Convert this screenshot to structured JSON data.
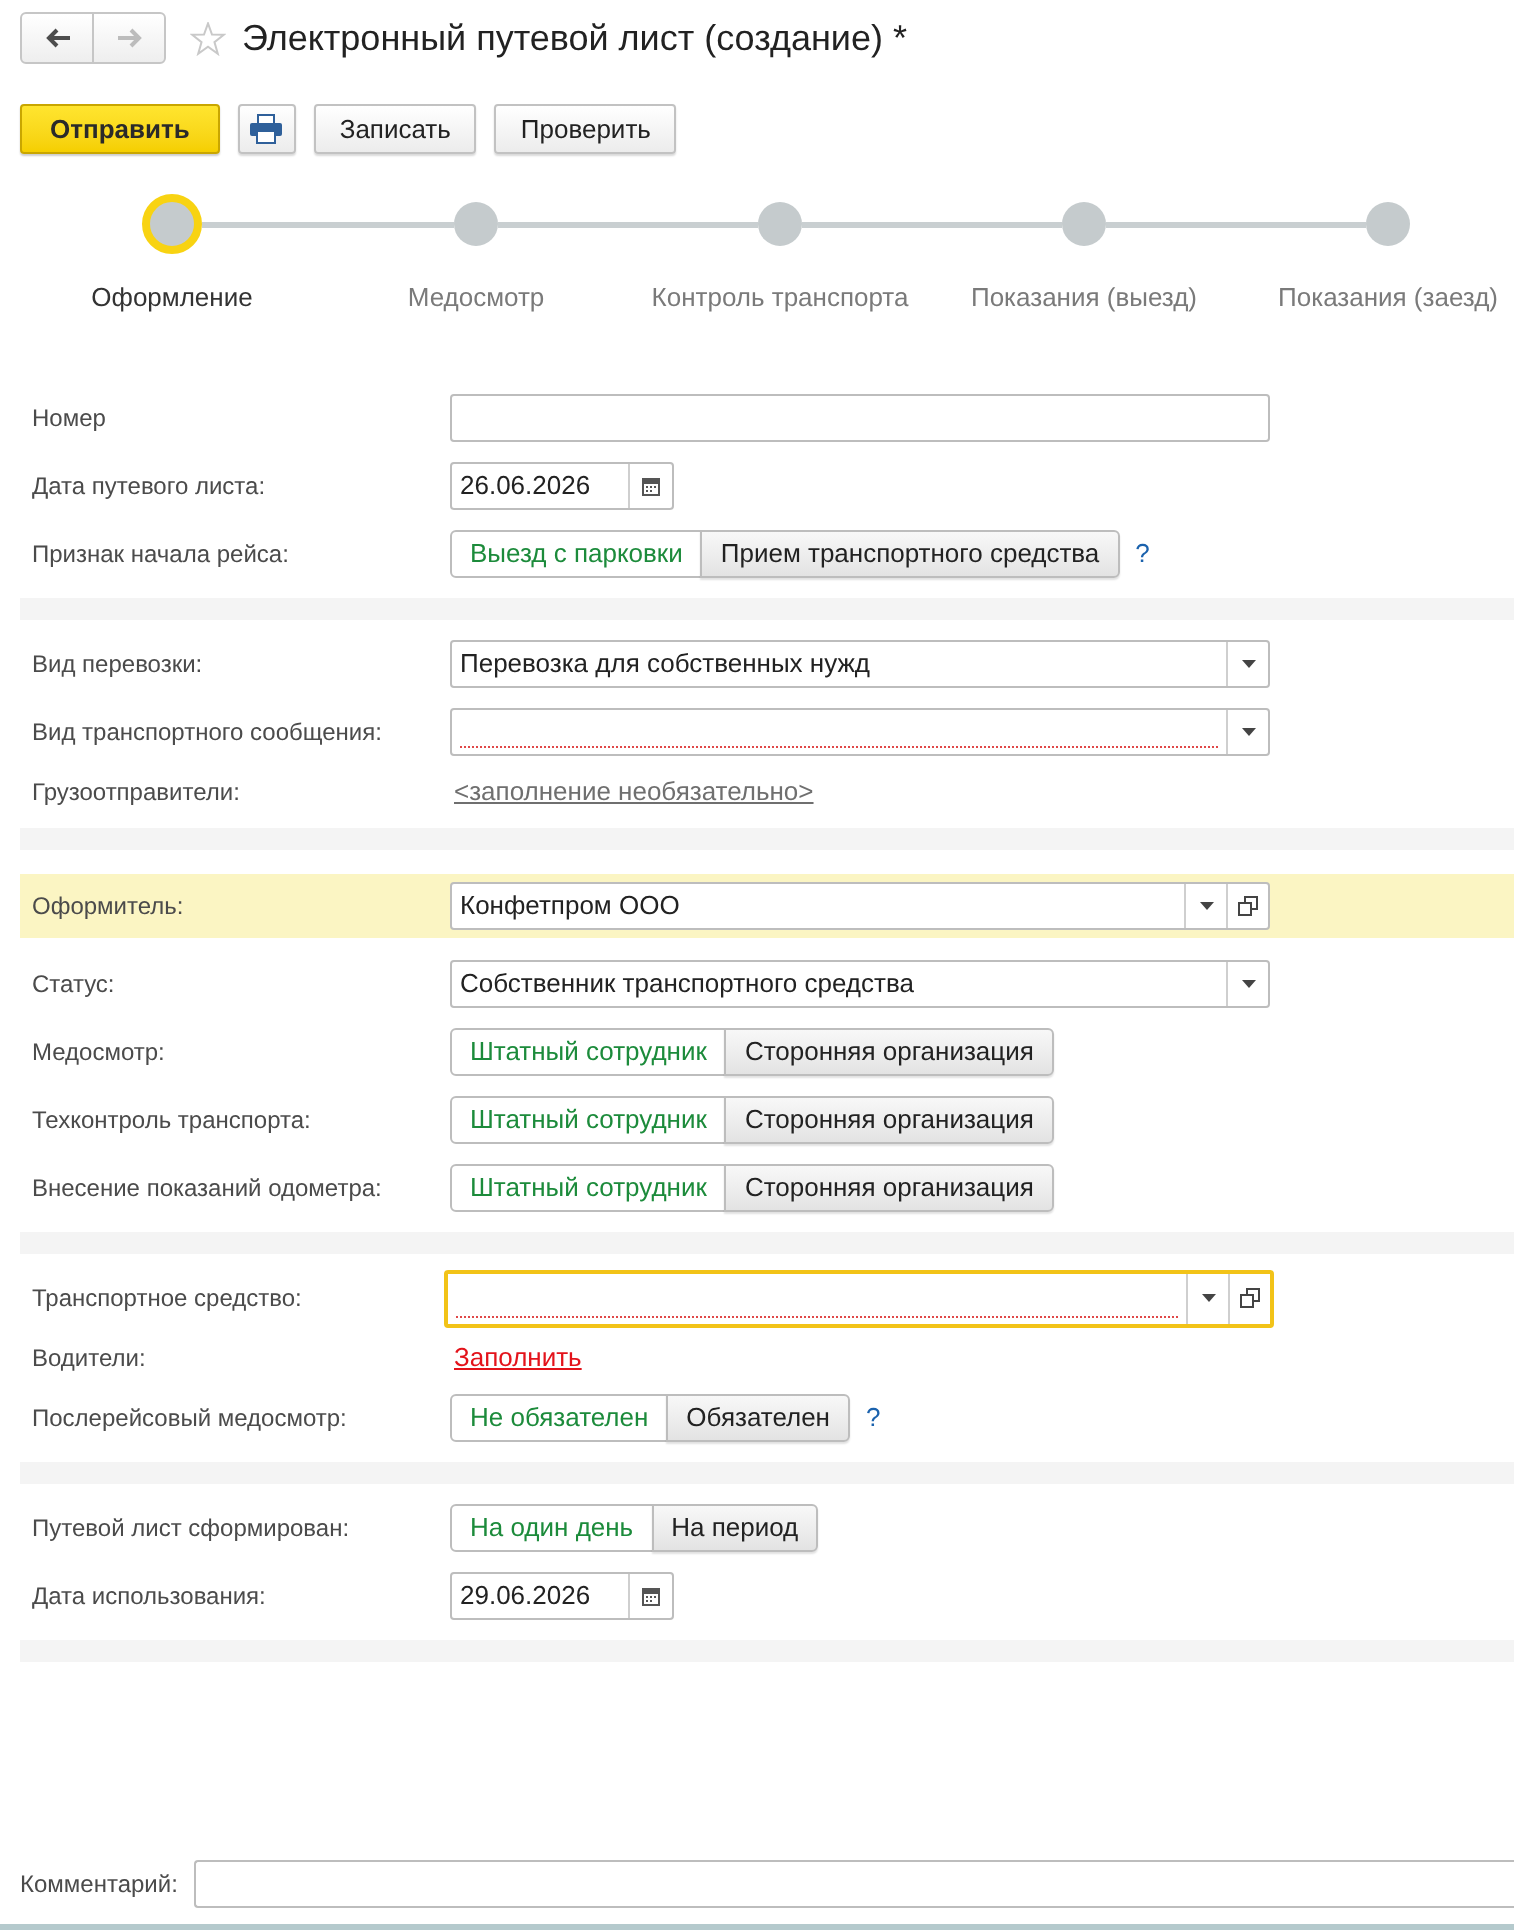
{
  "window": {
    "title": "Электронный путевой лист (создание) *",
    "favorite": false
  },
  "navigation": [
    {
      "kind": "back",
      "disabled": false
    },
    {
      "kind": "forward",
      "disabled": true
    }
  ],
  "toolbar": [
    {
      "kind": "primary",
      "label": "Отправить"
    },
    {
      "kind": "print"
    },
    {
      "kind": "default",
      "label": "Записать"
    },
    {
      "kind": "default",
      "label": "Проверить"
    }
  ],
  "steps": [
    {
      "label": "Оформление",
      "selected": true
    },
    {
      "label": "Медосмотр",
      "selected": false
    },
    {
      "label": "Контроль транспорта",
      "selected": false
    },
    {
      "label": "Показания (выезд)",
      "selected": false
    },
    {
      "label": "Показания (заезд)",
      "selected": false
    }
  ],
  "sections": [
    {
      "fields": [
        {
          "kind": "input",
          "label": "Номер"
        },
        {
          "kind": "date",
          "label": "Дата путевого листа:",
          "value": "26.06.2026"
        },
        {
          "kind": "toggle",
          "label": "Признак начала рейса:",
          "options": [
            {
              "label": "Выезд с парковки",
              "selected": true
            },
            {
              "label": "Прием транспортного средства",
              "selected": false
            }
          ],
          "help": "?"
        }
      ]
    },
    {
      "fields": [
        {
          "kind": "combo",
          "label": "Вид перевозки:",
          "value": "Перевозка для собственных нужд",
          "required": false,
          "focused": false,
          "highlighted": false,
          "open_button": false
        },
        {
          "kind": "combo",
          "label": "Вид транспортного сообщения:",
          "required": true,
          "focused": false,
          "highlighted": false,
          "open_button": false
        },
        {
          "kind": "link",
          "label": "Грузоотправители:",
          "text": "<заполнение необязательно>",
          "required": false
        }
      ]
    },
    {
      "fields": [
        {
          "kind": "combo",
          "label": "Оформитель:",
          "value": "Конфетпром ООО",
          "required": false,
          "focused": false,
          "highlighted": true,
          "open_button": true
        },
        {
          "kind": "combo",
          "label": "Статус:",
          "value": "Собственник транспортного средства",
          "required": false,
          "focused": false,
          "highlighted": false,
          "open_button": false
        },
        {
          "kind": "toggle",
          "label": "Медосмотр:",
          "options": [
            {
              "label": "Штатный сотрудник",
              "selected": true
            },
            {
              "label": "Сторонняя организация",
              "selected": false
            }
          ]
        },
        {
          "kind": "toggle",
          "label": "Техконтроль транспорта:",
          "options": [
            {
              "label": "Штатный сотрудник",
              "selected": true
            },
            {
              "label": "Сторонняя организация",
              "selected": false
            }
          ]
        },
        {
          "kind": "toggle",
          "label": "Внесение показаний одометра:",
          "options": [
            {
              "label": "Штатный сотрудник",
              "selected": true
            },
            {
              "label": "Сторонняя организация",
              "selected": false
            }
          ]
        }
      ]
    },
    {
      "fields": [
        {
          "kind": "combo",
          "label": "Транспортное средство:",
          "required": true,
          "focused": true,
          "highlighted": false,
          "open_button": true
        },
        {
          "kind": "link",
          "label": "Водители:",
          "text": "Заполнить",
          "required": true
        },
        {
          "kind": "toggle",
          "label": "Послерейсовый медосмотр:",
          "options": [
            {
              "label": "Не обязателен",
              "selected": true
            },
            {
              "label": "Обязателен",
              "selected": false
            }
          ],
          "help": "?"
        }
      ]
    },
    {
      "fields": [
        {
          "kind": "toggle",
          "label": "Путевой лист сформирован:",
          "options": [
            {
              "label": "На один день",
              "selected": true
            },
            {
              "label": "На период",
              "selected": false
            }
          ]
        },
        {
          "kind": "date",
          "label": "Дата использования:",
          "value": "29.06.2026"
        }
      ]
    }
  ],
  "comment": {
    "label": "Комментарий:"
  }
}
